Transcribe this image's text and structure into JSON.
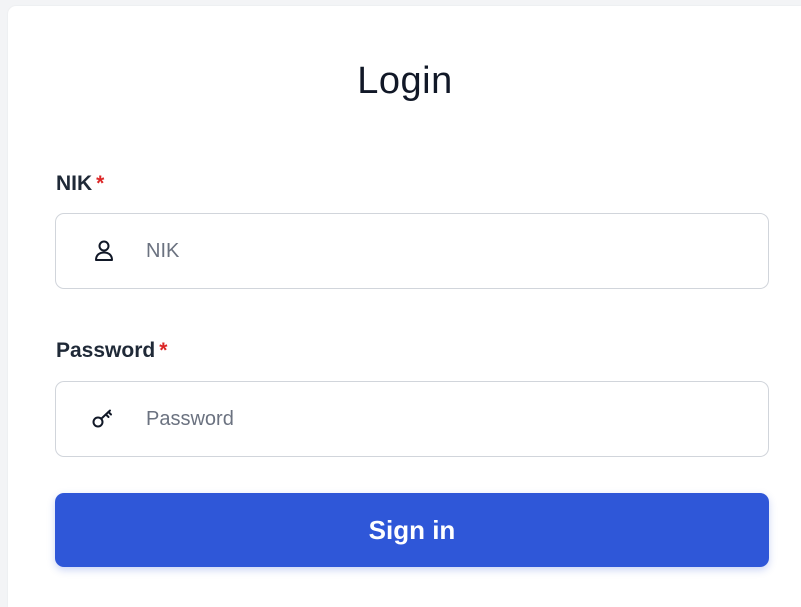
{
  "login": {
    "title": "Login",
    "nik": {
      "label": "NIK",
      "required_mark": "*",
      "placeholder": "NIK",
      "value": "",
      "icon": "user-icon"
    },
    "password": {
      "label": "Password",
      "required_mark": "*",
      "placeholder": "Password",
      "value": "",
      "icon": "key-icon"
    },
    "submit_label": "Sign in"
  },
  "colors": {
    "accent": "#2f57d8",
    "required": "#dc2626",
    "text": "#111827",
    "placeholder": "#6b7280",
    "border": "#d1d5db"
  }
}
